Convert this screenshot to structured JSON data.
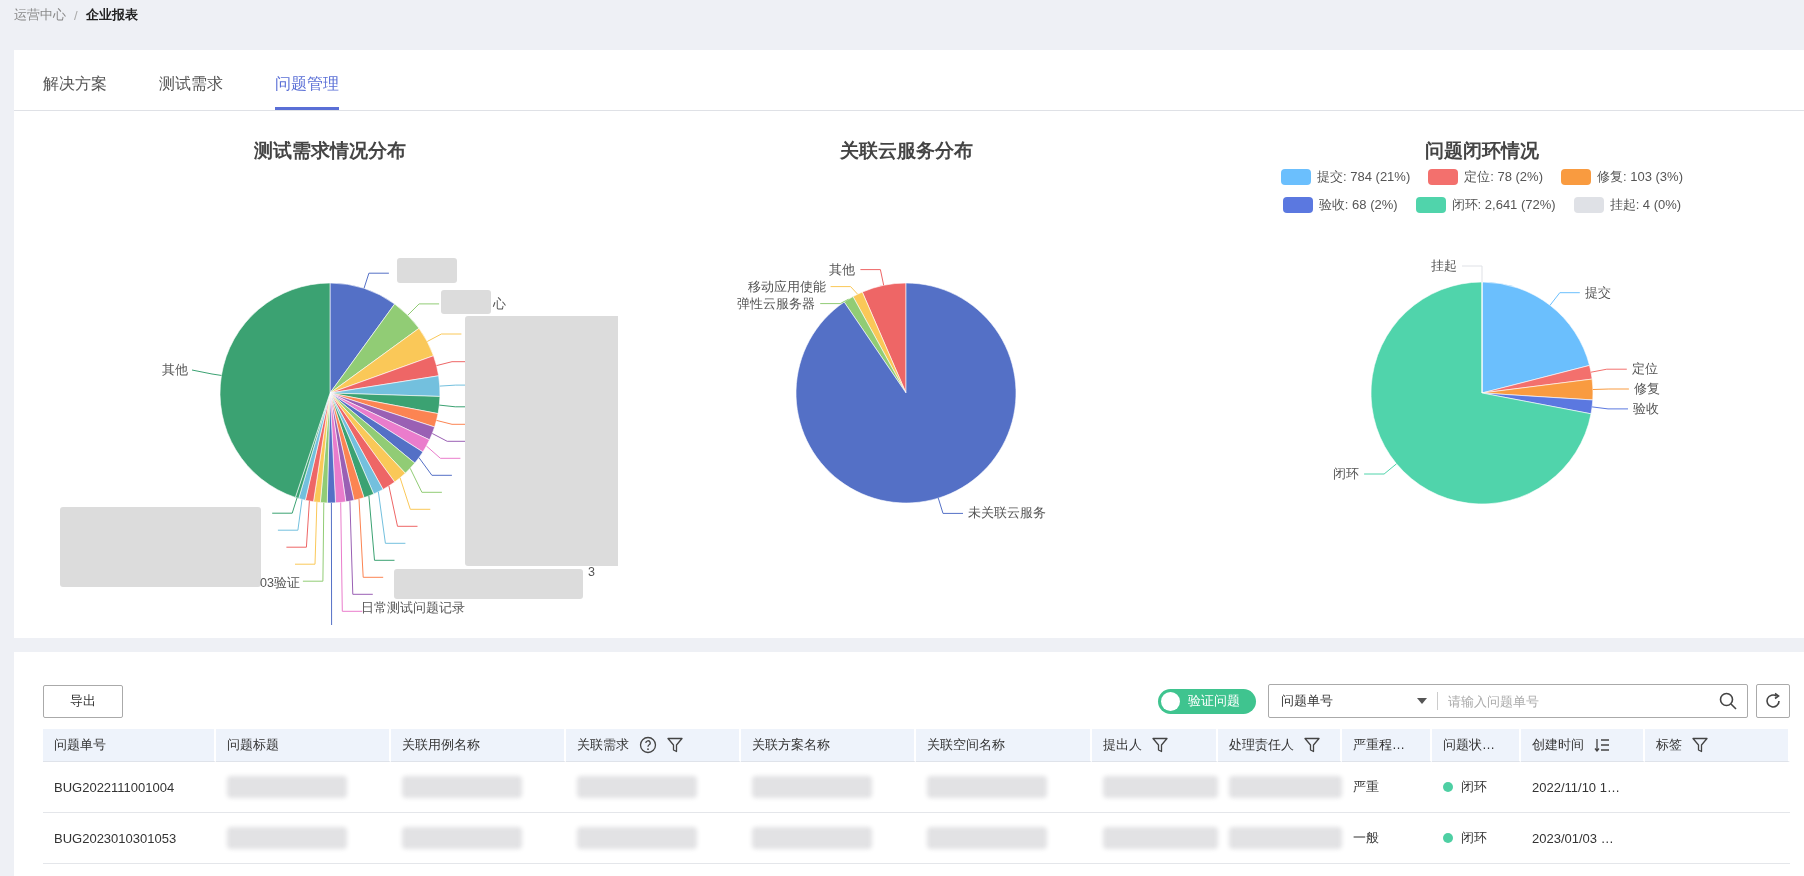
{
  "breadcrumb": {
    "separator": "/",
    "items": [
      {
        "text": "运营中心",
        "current": false
      },
      {
        "text": "企业报表",
        "current": true
      }
    ]
  },
  "tabs": [
    {
      "label": "解决方案",
      "selected": false
    },
    {
      "label": "测试需求",
      "selected": false
    },
    {
      "label": "问题管理",
      "selected": true
    }
  ],
  "requirement_chart": {
    "title": "测试需求情况分布",
    "labels": [
      "其他",
      "心",
      "3",
      "03验证",
      "日常测试问题记录"
    ]
  },
  "cloud_chart": {
    "title": "关联云服务分布",
    "slices": [
      {
        "label": "其他",
        "color": "#ee6666"
      },
      {
        "label": "移动应用使能",
        "color": "#fac858"
      },
      {
        "label": "弹性云服务器",
        "color": "#91cc75"
      },
      {
        "label": "未关联云服务",
        "color": "#5470c6"
      }
    ]
  },
  "closure_chart": {
    "legend": [
      {
        "text": "提交: 784 (21%)",
        "color": "#6bbffd"
      },
      {
        "text": "定位: 78 (2%)",
        "color": "#f3706d"
      },
      {
        "text": "修复: 103 (3%)",
        "color": "#f99b40"
      },
      {
        "text": "验收: 68 (2%)",
        "color": "#5b78e0"
      },
      {
        "text": "闭环: 2,641 (72%)",
        "color": "#50d4ab"
      },
      {
        "text": "挂起: 4 (0%)",
        "color": "#dfe1e6"
      }
    ],
    "chart_data": {
      "type": "pie",
      "title": "问题闭环情况",
      "categories": [
        "提交",
        "定位",
        "修复",
        "验收",
        "闭环",
        "挂起"
      ],
      "series": [
        {
          "values": [
            21,
            2,
            3,
            2,
            72,
            0
          ]
        }
      ]
    }
  },
  "toolbar": {
    "export_button": "导出",
    "toggle": {
      "label": "验证问题",
      "on": true
    },
    "search_select": "问题单号",
    "search_placeholder": "请输入问题单号"
  },
  "table": {
    "columns": [
      {
        "label": "问题单号"
      },
      {
        "label": "问题标题"
      },
      {
        "label": "关联用例名称"
      },
      {
        "label": "关联需求",
        "help_icon": true,
        "filter_icon": true
      },
      {
        "label": "关联方案名称"
      },
      {
        "label": "关联空间名称"
      },
      {
        "label": "提出人",
        "filter_icon": true
      },
      {
        "label": "处理责任人",
        "filter_icon": true
      },
      {
        "label": "严重程…"
      },
      {
        "label": "问题状…"
      },
      {
        "label": "创建时间",
        "sort_icon": true
      },
      {
        "label": "标签",
        "filter_icon": true
      }
    ],
    "rows": [
      {
        "id": "BUG2022111001004",
        "severity": "严重",
        "status": {
          "text": "闭环",
          "color": "#4ecfa3"
        },
        "created": "2022/11/10 1…"
      },
      {
        "id": "BUG2023010301053",
        "severity": "一般",
        "status": {
          "text": "闭环",
          "color": "#4ecfa3"
        },
        "created": "2023/01/03 …"
      }
    ]
  }
}
